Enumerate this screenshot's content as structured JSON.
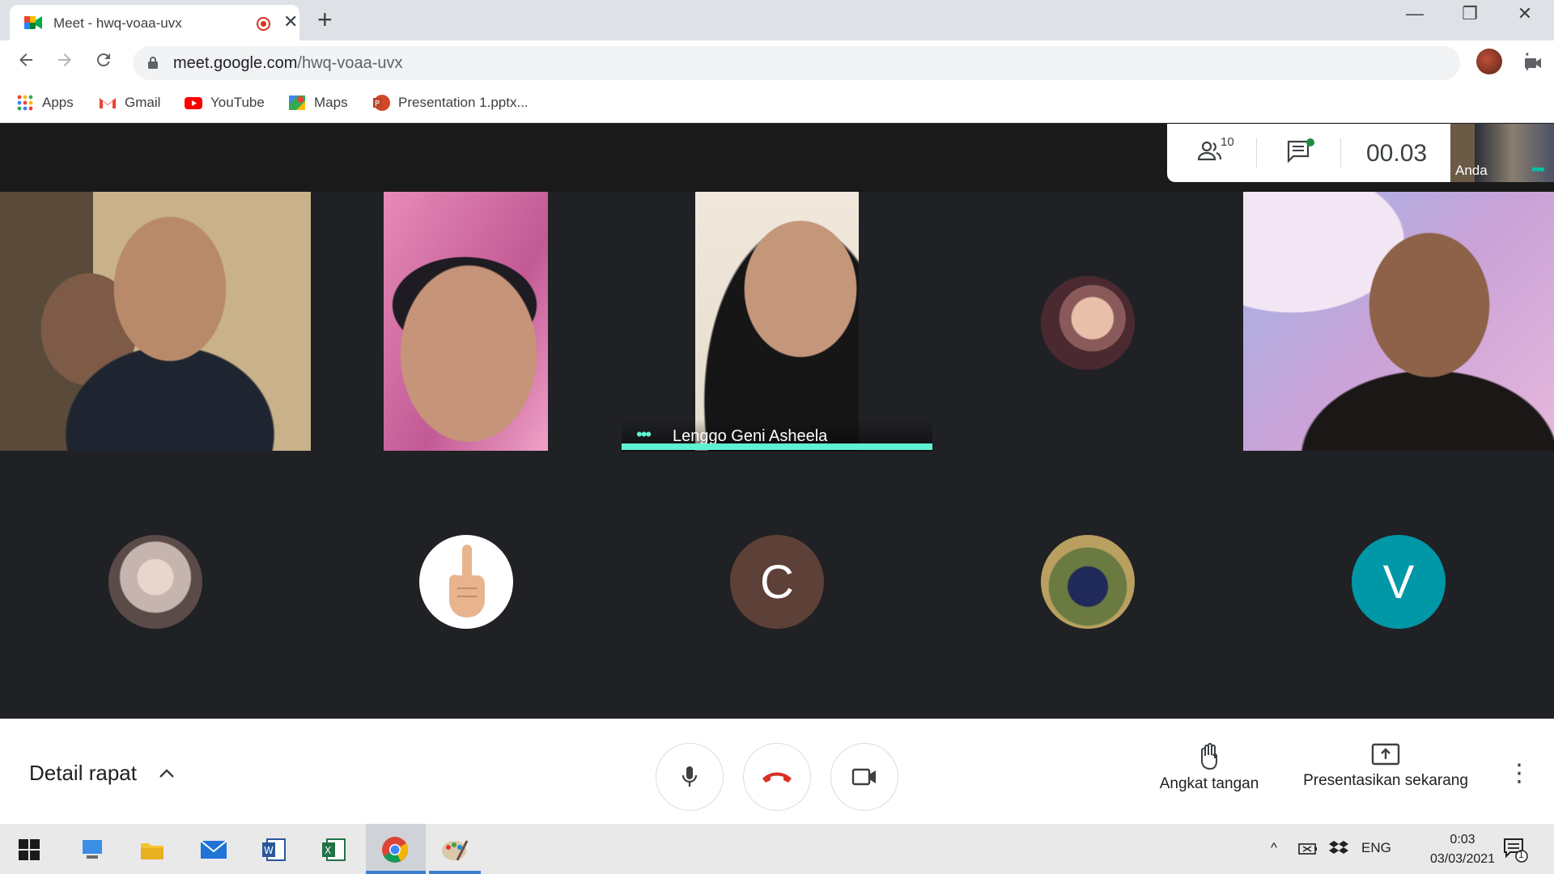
{
  "browser": {
    "tab_title": "Meet - hwq-voaa-uvx",
    "tab_close": "✕",
    "new_tab": "+",
    "url_domain": "meet.google.com",
    "url_path": "/hwq-voaa-uvx",
    "window_controls": {
      "minimize": "—",
      "restore": "❐",
      "close": "✕"
    }
  },
  "bookmarks": [
    {
      "label": "Apps",
      "icon": "apps-grid-icon"
    },
    {
      "label": "Gmail",
      "icon": "gmail-icon"
    },
    {
      "label": "YouTube",
      "icon": "youtube-icon"
    },
    {
      "label": "Maps",
      "icon": "maps-icon"
    },
    {
      "label": "Presentation 1.pptx...",
      "icon": "powerpoint-icon"
    }
  ],
  "meet": {
    "participants_count": "10",
    "timer": "00.03",
    "self_view_name": "Anda",
    "active_speaker": "Lenggo Geni Asheela",
    "avatar_letters": [
      "C",
      "V"
    ],
    "avatar_colors": {
      "c": "#5d4037",
      "v": "#0097a7"
    },
    "accent_color": "#5ef2d2"
  },
  "controls": {
    "details_label": "Detail rapat",
    "raise_hand_label": "Angkat tangan",
    "present_label": "Presentasikan sekarang"
  },
  "taskbar": {
    "language": "ENG",
    "time": "0:03",
    "date": "03/03/2021",
    "notification_count": "1"
  }
}
